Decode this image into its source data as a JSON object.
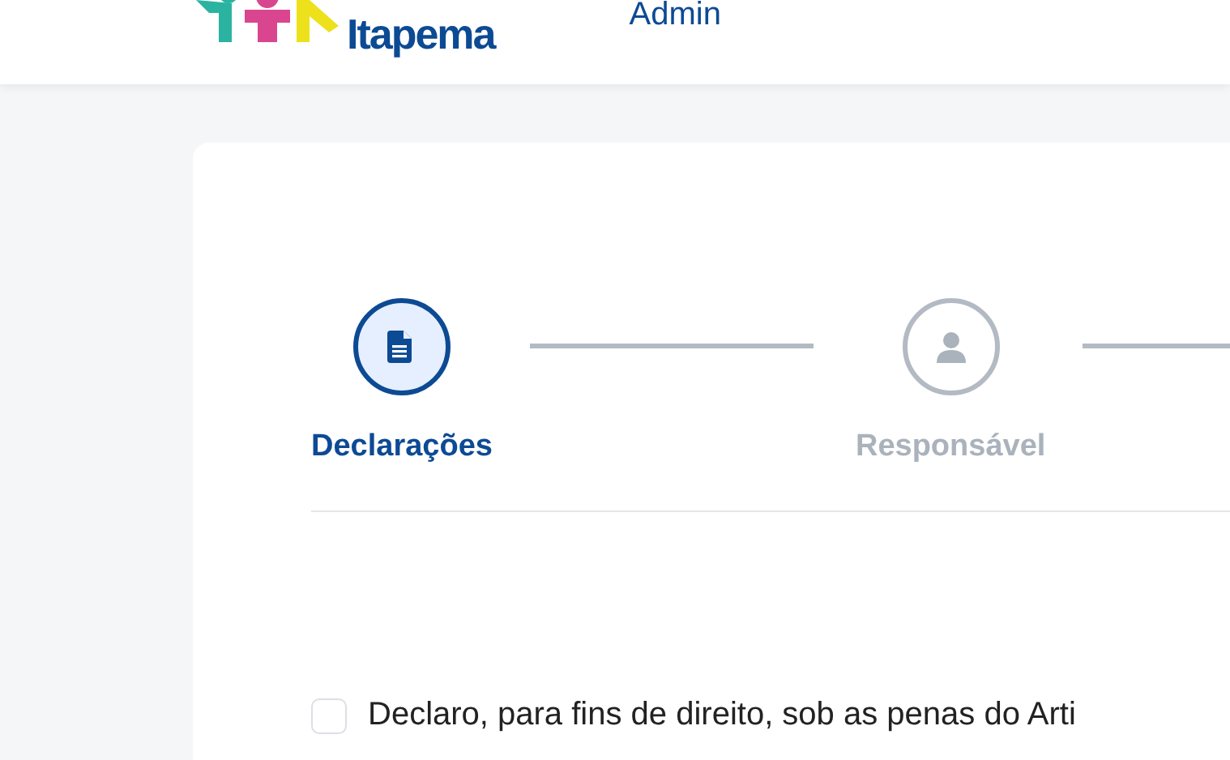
{
  "header": {
    "logo": {
      "line_2": "Itapema"
    },
    "user": "Admin"
  },
  "stepper": {
    "steps": [
      {
        "label": "Declarações",
        "selected": true
      },
      {
        "label": "Responsável",
        "selected": false
      }
    ],
    "trailing_connector": true
  },
  "declarations": [
    {
      "text": "Declaro, para fins de direito, sob as penas do Arti",
      "checked": false
    }
  ]
}
